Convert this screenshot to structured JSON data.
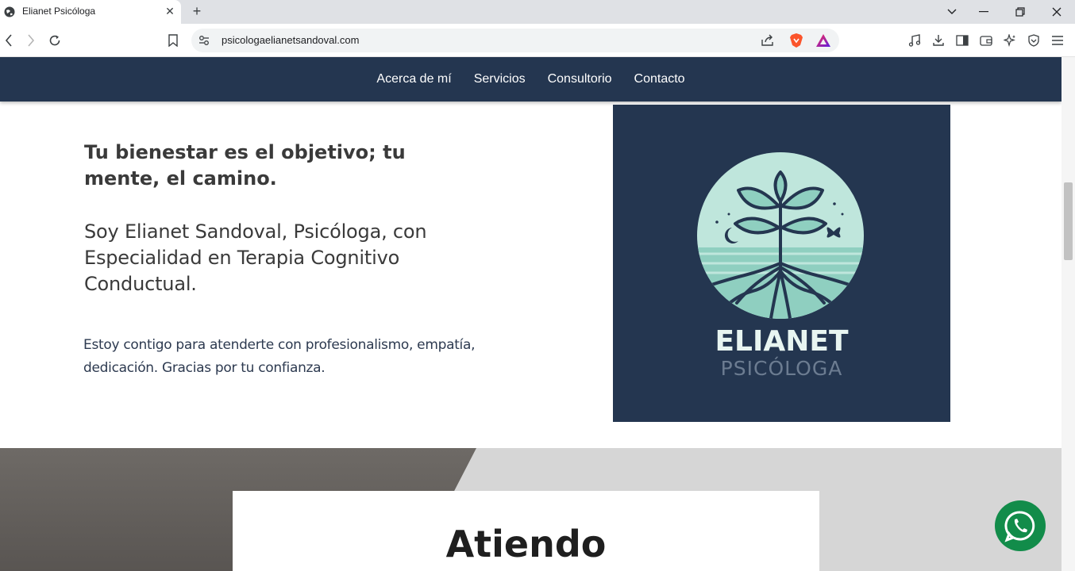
{
  "browser": {
    "tab_title": "Elianet Psicóloga",
    "tab_close": "✕",
    "new_tab": "+",
    "url": "psicologaelianetsandoval.com"
  },
  "nav": {
    "links": [
      "Acerca de mí",
      "Servicios",
      "Consultorio",
      "Contacto"
    ]
  },
  "hero": {
    "headline": "Tu bienestar es el objetivo; tu mente, el camino.",
    "intro": "Soy Elianet Sandoval, Psicóloga, con Especialidad en Terapia Cognitivo Conductual.",
    "body": "Estoy contigo para atenderte con profesionalismo, empatía, dedicación. Gracias por tu confianza."
  },
  "logo": {
    "name": "ELIANET",
    "subtitle": "PSICÓLOGA"
  },
  "section": {
    "title": "Atiendo"
  },
  "colors": {
    "navbar": "#243650",
    "logo_bg": "#243650",
    "mint": "#a8dccf",
    "whatsapp": "#128c4a"
  },
  "icons": {
    "whatsapp": "whatsapp-icon",
    "brave": "brave-shield-icon"
  }
}
